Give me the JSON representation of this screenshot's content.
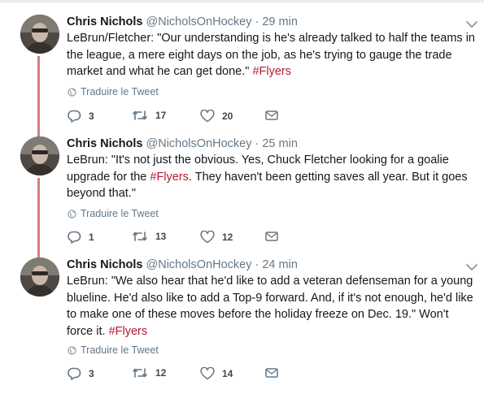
{
  "tweets": [
    {
      "name": "Chris Nichols",
      "handle": "@NicholsOnHockey",
      "time": "· 29 min",
      "text_before": "LeBrun/Fletcher: \"Our understanding is he's already talked to half the teams in the league, a mere eight days on the job, as he's trying to gauge the trade market and what he can get done.\" ",
      "hashtag": "#Flyers",
      "text_after": "",
      "translate": "Traduire le Tweet",
      "replies": "3",
      "retweets": "17",
      "likes": "20"
    },
    {
      "name": "Chris Nichols",
      "handle": "@NicholsOnHockey",
      "time": "· 25 min",
      "text_before": "LeBrun: \"It's not just the obvious. Yes, Chuck Fletcher looking for a goalie upgrade for the ",
      "hashtag": "#Flyers",
      "text_after": ". They haven't been getting saves all year. But it goes beyond that.\"",
      "translate": "Traduire le Tweet",
      "replies": "1",
      "retweets": "13",
      "likes": "12"
    },
    {
      "name": "Chris Nichols",
      "handle": "@NicholsOnHockey",
      "time": "· 24 min",
      "text_before": "LeBrun: \"We also hear that he'd like to add a veteran defenseman for a young blueline. He'd also like to add a Top-9 forward. And, if it's not enough, he'd like to make one of these moves before the holiday freeze on Dec. 19.\" Won't force it. ",
      "hashtag": "#Flyers",
      "text_after": "",
      "translate": "Traduire le Tweet",
      "replies": "3",
      "retweets": "12",
      "likes": "14"
    }
  ],
  "colors": {
    "hashtag": "#b5192f",
    "thread_line": "#d67e84",
    "meta": "#657786"
  },
  "icons": [
    "chevron-down-icon",
    "globe-icon",
    "reply-icon",
    "retweet-icon",
    "like-icon",
    "message-icon"
  ]
}
